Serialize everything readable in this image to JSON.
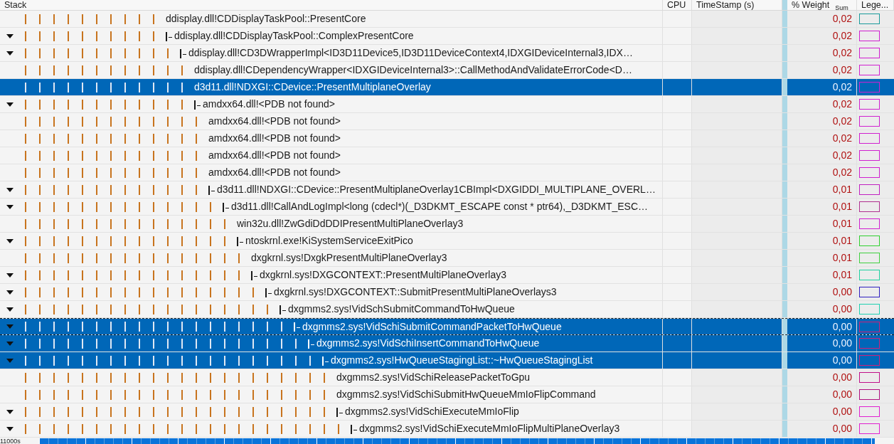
{
  "table": {
    "columns": [
      {
        "label": "Stack"
      },
      {
        "label": "CPU"
      },
      {
        "label": "TimeStamp (s)"
      },
      {
        "label": "% Weight",
        "aggregation": "Sum"
      },
      {
        "label": "Lege..."
      }
    ],
    "rows": [
      {
        "function": "ddisplay.dll!CDDisplayTaskPool::PresentCore",
        "branch": false,
        "expanded": false,
        "selected": false,
        "focused": false,
        "weight": "0,02",
        "color": "#1a9a9a"
      },
      {
        "function": "ddisplay.dll!CDDisplayTaskPool::ComplexPresentCore",
        "branch": true,
        "expanded": true,
        "selected": false,
        "focused": false,
        "weight": "0,02",
        "color": "#d020d0",
        "children": [
          {
            "function": "ddisplay.dll!CD3DWrapperImpl<ID3D11Device5,ID3D11DeviceContext4,IDXGIDeviceInternal3,IDX…",
            "branch": true,
            "expanded": true,
            "selected": false,
            "focused": false,
            "weight": "0,02",
            "color": "#d020d0",
            "children": [
              {
                "function": "ddisplay.dll!CDependencyWrapper<IDXGIDeviceInternal3>::CallMethodAndValidateErrorCode<D…",
                "branch": false,
                "expanded": false,
                "selected": false,
                "focused": false,
                "weight": "0,02",
                "color": "#d020d0"
              },
              {
                "function": "d3d11.dll!NDXGI::CDevice::PresentMultiplaneOverlay",
                "branch": false,
                "expanded": false,
                "selected": true,
                "focused": false,
                "weight": "0,02",
                "color": "#d020d0"
              },
              {
                "function": "amdxx64.dll!<PDB not found>",
                "branch": true,
                "expanded": true,
                "selected": false,
                "focused": false,
                "weight": "0,02",
                "color": "#d020d0",
                "children": [
                  {
                    "function": "amdxx64.dll!<PDB not found>",
                    "branch": false,
                    "expanded": false,
                    "selected": false,
                    "focused": false,
                    "weight": "0,02",
                    "color": "#d020d0"
                  },
                  {
                    "function": "amdxx64.dll!<PDB not found>",
                    "branch": false,
                    "expanded": false,
                    "selected": false,
                    "focused": false,
                    "weight": "0,02",
                    "color": "#d020d0"
                  },
                  {
                    "function": "amdxx64.dll!<PDB not found>",
                    "branch": false,
                    "expanded": false,
                    "selected": false,
                    "focused": false,
                    "weight": "0,02",
                    "color": "#d020d0"
                  },
                  {
                    "function": "amdxx64.dll!<PDB not found>",
                    "branch": false,
                    "expanded": false,
                    "selected": false,
                    "focused": false,
                    "weight": "0,02",
                    "color": "#d020d0"
                  },
                  {
                    "function": "d3d11.dll!NDXGI::CDevice::PresentMultiplaneOverlay1CBImpl<DXGIDDI_MULTIPLANE_OVERL…",
                    "branch": true,
                    "expanded": true,
                    "selected": false,
                    "focused": false,
                    "weight": "0,01",
                    "color": "#c020c0",
                    "children": [
                      {
                        "function": "d3d11.dll!CallAndLogImpl<long (cdecl*)(_D3DKMT_ESCAPE const * ptr64),_D3DKMT_ESC…",
                        "branch": true,
                        "expanded": true,
                        "selected": false,
                        "focused": false,
                        "weight": "0,01",
                        "color": "#b03090",
                        "children": [
                          {
                            "function": "win32u.dll!ZwGdiDdDDIPresentMultiPlaneOverlay3",
                            "branch": false,
                            "expanded": false,
                            "selected": false,
                            "focused": false,
                            "weight": "0,01",
                            "color": "#d020d0"
                          },
                          {
                            "function": "ntoskrnl.exe!KiSystemServiceExitPico",
                            "branch": true,
                            "expanded": true,
                            "selected": false,
                            "focused": false,
                            "weight": "0,01",
                            "color": "#30d030",
                            "children": [
                              {
                                "function": "dxgkrnl.sys!DxgkPresentMultiPlaneOverlay3",
                                "branch": false,
                                "expanded": false,
                                "selected": false,
                                "focused": false,
                                "weight": "0,01",
                                "color": "#40d040"
                              },
                              {
                                "function": "dxgkrnl.sys!DXGCONTEXT::PresentMultiPlaneOverlay3",
                                "branch": true,
                                "expanded": true,
                                "selected": false,
                                "focused": false,
                                "weight": "0,01",
                                "color": "#20d0a0",
                                "children": [
                                  {
                                    "function": "dxgkrnl.sys!DXGCONTEXT::SubmitPresentMultiPlaneOverlays3",
                                    "branch": true,
                                    "expanded": true,
                                    "selected": false,
                                    "focused": false,
                                    "weight": "0,00",
                                    "color": "#3020c0",
                                    "children": [
                                      {
                                        "function": "dxgmms2.sys!VidSchSubmitCommandToHwQueue",
                                        "branch": true,
                                        "expanded": true,
                                        "selected": false,
                                        "focused": false,
                                        "weight": "0,00",
                                        "color": "#20d0b0",
                                        "children": [
                                          {
                                            "function": "dxgmms2.sys!VidSchiSubmitCommandPacketToHwQueue",
                                            "branch": true,
                                            "expanded": true,
                                            "selected": true,
                                            "focused": true,
                                            "weight": "0,00",
                                            "color": "#d0207a",
                                            "children": [
                                              {
                                                "function": "dxgmms2.sys!VidSchiInsertCommandToHwQueue",
                                                "branch": true,
                                                "expanded": true,
                                                "selected": true,
                                                "focused": false,
                                                "weight": "0,00",
                                                "color": "#d0207a",
                                                "children": [
                                                  {
                                                    "function": "dxgmms2.sys!HwQueueStagingList::~HwQueueStagingList",
                                                    "branch": true,
                                                    "expanded": true,
                                                    "selected": true,
                                                    "focused": false,
                                                    "weight": "0,00",
                                                    "color": "#d0207a",
                                                    "children": [
                                                      {
                                                        "function": "dxgmms2.sys!VidSchiReleasePacketToGpu",
                                                        "branch": false,
                                                        "expanded": false,
                                                        "selected": false,
                                                        "focused": false,
                                                        "weight": "0,00",
                                                        "color": "#c0108a"
                                                      },
                                                      {
                                                        "function": "dxgmms2.sys!VidSchiSubmitHwQueueMmIoFlipCommand",
                                                        "branch": false,
                                                        "expanded": false,
                                                        "selected": false,
                                                        "focused": false,
                                                        "weight": "0,00",
                                                        "color": "#b01080"
                                                      },
                                                      {
                                                        "function": "dxgmms2.sys!VidSchiExecuteMmIoFlip",
                                                        "branch": true,
                                                        "expanded": true,
                                                        "selected": false,
                                                        "focused": false,
                                                        "weight": "0,00",
                                                        "color": "#e020d0",
                                                        "children": [
                                                          {
                                                            "function": "dxgmms2.sys!VidSchiExecuteMmIoFlipMultiPlaneOverlay3",
                                                            "branch": true,
                                                            "expanded": true,
                                                            "selected": false,
                                                            "focused": false,
                                                            "weight": "0,00",
                                                            "color": "#e020d0"
                                                          }
                                                        ]
                                                      }
                                                    ]
                                                  }
                                                ]
                                              }
                                            ]
                                          }
                                        ]
                                      }
                                    ]
                                  }
                                ]
                              }
                            ]
                          }
                        ]
                      }
                    ]
                  }
                ]
              }
            ]
          }
        ]
      }
    ]
  },
  "timeline": {
    "axis_label": "11000s"
  }
}
